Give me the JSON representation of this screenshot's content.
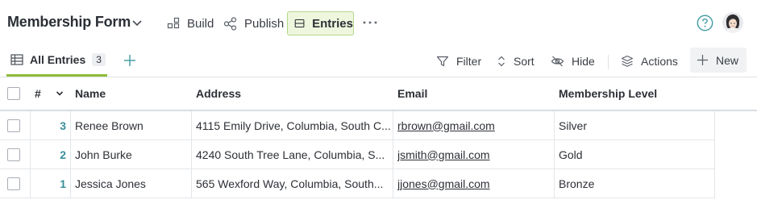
{
  "header": {
    "form_title": "Membership Form",
    "nav": {
      "build": "Build",
      "publish": "Publish",
      "entries": "Entries"
    }
  },
  "toolbar": {
    "tab_label": "All Entries",
    "tab_count": "3",
    "filter": "Filter",
    "sort": "Sort",
    "hide": "Hide",
    "actions": "Actions",
    "new": "New"
  },
  "table": {
    "columns": {
      "number": "#",
      "name": "Name",
      "address": "Address",
      "email": "Email",
      "level": "Membership Level"
    },
    "rows": [
      {
        "num": "3",
        "name": "Renee Brown",
        "address": "4115 Emily Drive, Columbia, South C...",
        "email": "rbrown@gmail.com",
        "level": "Silver"
      },
      {
        "num": "2",
        "name": "John Burke",
        "address": "4240 South Tree Lane, Columbia, S...",
        "email": "jsmith@gmail.com",
        "level": "Gold"
      },
      {
        "num": "1",
        "name": "Jessica Jones",
        "address": "565 Wexford Way, Columbia, South...",
        "email": "jjones@gmail.com",
        "level": "Bronze"
      }
    ]
  },
  "colors": {
    "accent_green": "#8fbd3c",
    "active_tab_bg": "#eef6de",
    "number_teal": "#3a8f9a",
    "help_icon": "#4aa0a6"
  },
  "icons": [
    "chevron-down-icon",
    "build-icon",
    "publish-icon",
    "entries-icon",
    "more-icon",
    "help-icon",
    "grid-icon",
    "plus-icon",
    "filter-icon",
    "sort-icon",
    "hide-icon",
    "actions-icon",
    "sort-desc-icon"
  ]
}
